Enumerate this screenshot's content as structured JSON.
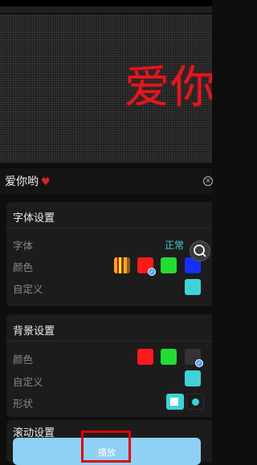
{
  "preview": {
    "text": "爱你哟",
    "color": "#e01820"
  },
  "input": {
    "value": "爱你哟",
    "heart": "♥",
    "clear_glyph": "×"
  },
  "font_section": {
    "title": "字体设置",
    "font_label": "字体",
    "font_value": "正常",
    "color_label": "颜色",
    "custom_label": "自定义",
    "swatches": [
      "gradient-orange",
      "#ff1a1a",
      "#22dd33",
      "#1a2eff"
    ],
    "selected_swatch": "#ff1a1a",
    "custom_color": "#3fd2d9"
  },
  "background_section": {
    "title": "背景设置",
    "color_label": "颜色",
    "custom_label": "自定义",
    "shape_label": "形状",
    "swatches": [
      "#ff1a1a",
      "#22dd33",
      "#333333"
    ],
    "selected_swatch": "#333333",
    "custom_color": "#3fd2d9",
    "shapes": [
      "square",
      "circle"
    ]
  },
  "scroll_section": {
    "title": "滚动设置"
  },
  "play_button": {
    "label": "播放"
  }
}
